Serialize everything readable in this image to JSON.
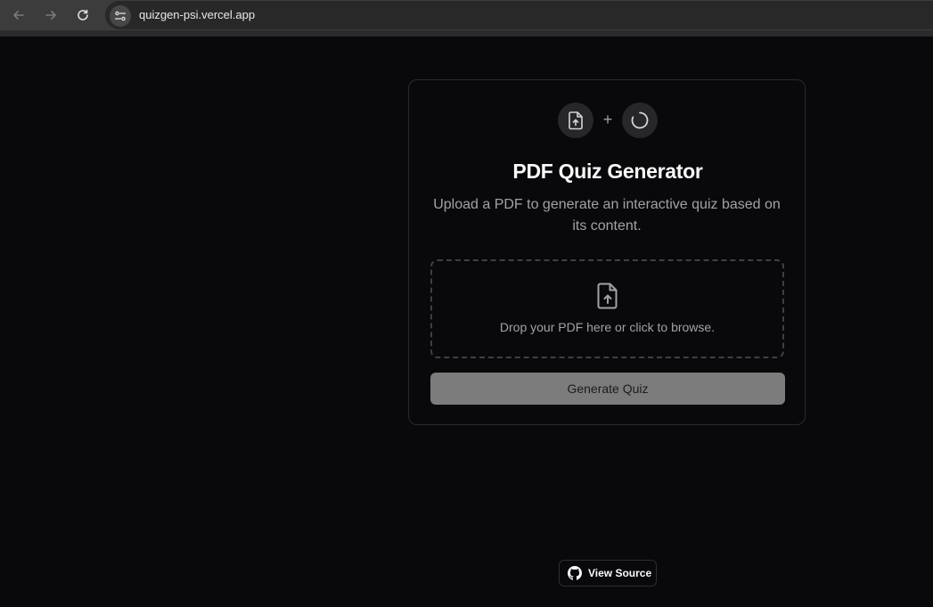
{
  "browser": {
    "url": "quizgen-psi.vercel.app",
    "icons": [
      "back-arrow-icon",
      "forward-arrow-icon",
      "reload-icon",
      "site-settings-icon"
    ]
  },
  "card": {
    "header_icons": [
      "file-upload-icon",
      "loader-icon"
    ],
    "plus": "+",
    "title": "PDF Quiz Generator",
    "subtitle": "Upload a PDF to generate an interactive quiz based on its content.",
    "dropzone": {
      "icon": "file-upload-icon",
      "text": "Drop your PDF here or click to browse."
    },
    "generate_label": "Generate Quiz"
  },
  "footer": {
    "view_source_label": "View Source",
    "icon": "github-icon"
  },
  "colors": {
    "background": "#09090b",
    "card_border": "#2a2a2e",
    "button_disabled": "#7c7c7c",
    "muted_text": "#a1a1aa",
    "icon_circle": "#27272a"
  }
}
